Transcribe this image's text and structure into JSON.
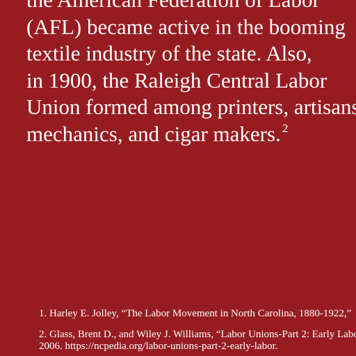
{
  "body": {
    "lines": [
      "the American Federation of Labor",
      "(AFL) became active in the booming",
      "textile industry of the state. Also,",
      "in 1900, the Raleigh Central Labor",
      "Union formed among printers, artisans,",
      "mechanics, and cigar makers."
    ],
    "footnote_marker": "2"
  },
  "footnotes": [
    {
      "text": "1. Harley E. Jolley, “The Labor Movement in North Carolina, 1880-1922,”"
    },
    {
      "line1": "2. Glass, Brent D., and Wiley J. Williams, “Labor Unions-Part 2: Early Labor,”",
      "line2": "2006. https://ncpedia.org/labor-unions-part-2-early-labor."
    }
  ]
}
